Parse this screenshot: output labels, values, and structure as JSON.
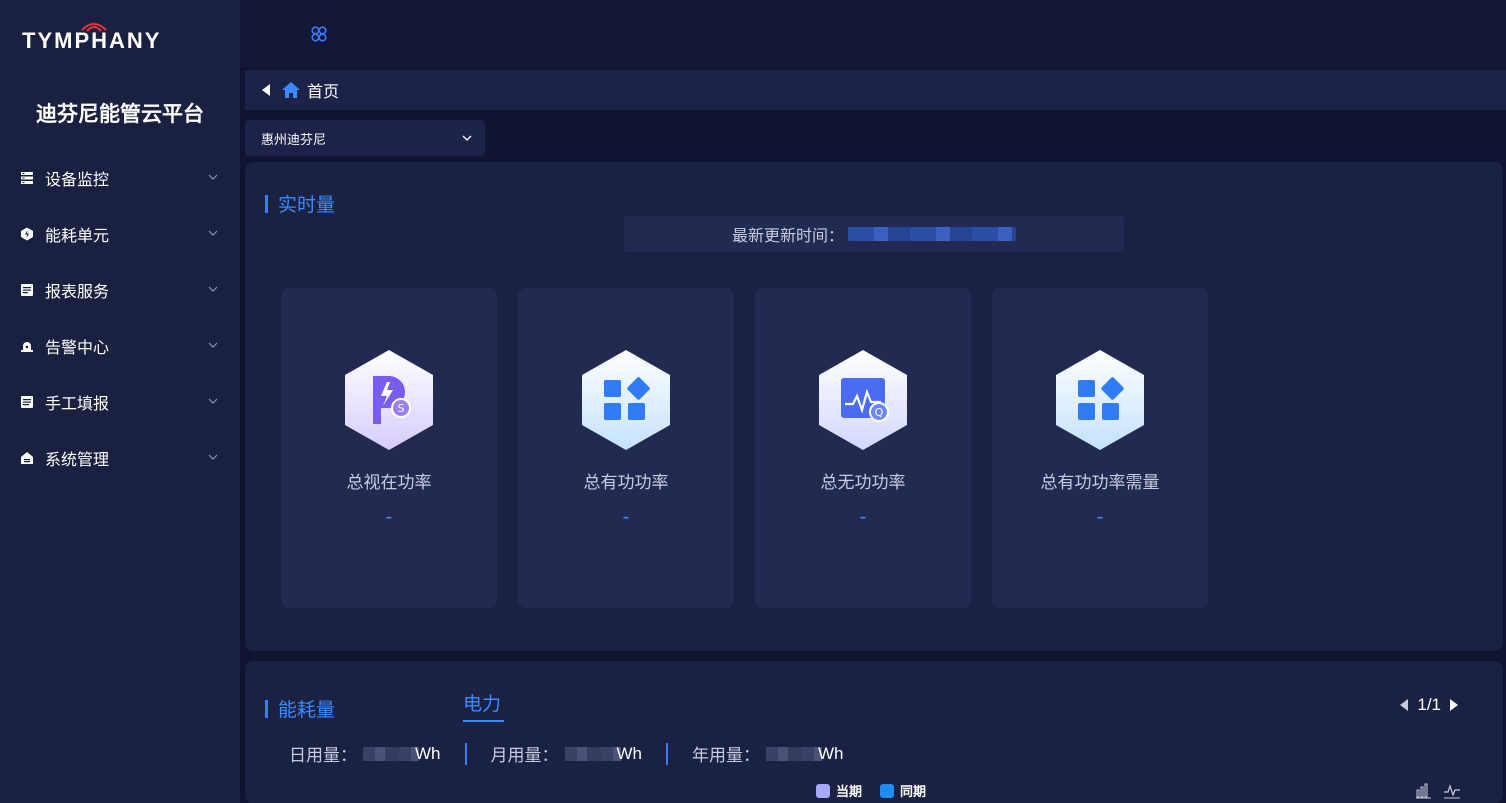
{
  "brand": {
    "logo_text": "TYMPHANY",
    "platform_title": "迪芬尼能管云平台",
    "accent_color": "#3a8bff",
    "logo_wave_color": "#e8343a"
  },
  "sidebar": {
    "items": [
      {
        "label": "设备监控",
        "icon": "server-icon"
      },
      {
        "label": "能耗单元",
        "icon": "hexagon-bolt-icon"
      },
      {
        "label": "报表服务",
        "icon": "report-icon"
      },
      {
        "label": "告警中心",
        "icon": "alarm-icon"
      },
      {
        "label": "手工填报",
        "icon": "form-icon"
      },
      {
        "label": "系统管理",
        "icon": "settings-box-icon"
      }
    ]
  },
  "topbar": {
    "menu_icon": "collapse-menu-icon"
  },
  "breadcrumb": {
    "label": "首页"
  },
  "site_select": {
    "value": "惠州迪芬尼"
  },
  "realtime": {
    "title": "实时量",
    "update_label": "最新更新时间：",
    "metrics": [
      {
        "label": "总视在功率",
        "value": "-",
        "icon": "apparent-power-icon"
      },
      {
        "label": "总有功功率",
        "value": "-",
        "icon": "active-power-icon"
      },
      {
        "label": "总无功功率",
        "value": "-",
        "icon": "reactive-power-icon"
      },
      {
        "label": "总有功功率需量",
        "value": "-",
        "icon": "active-demand-icon"
      }
    ]
  },
  "energy": {
    "title": "能耗量",
    "tab": "电力",
    "pager": "1/1",
    "usage": [
      {
        "label": "日用量：",
        "unit": "Wh"
      },
      {
        "label": "月用量：",
        "unit": "Wh"
      },
      {
        "label": "年用量：",
        "unit": "Wh"
      }
    ],
    "legend": [
      {
        "label": "当期",
        "color": "#a9a8ff"
      },
      {
        "label": "同期",
        "color": "#1e8cf0"
      }
    ]
  }
}
